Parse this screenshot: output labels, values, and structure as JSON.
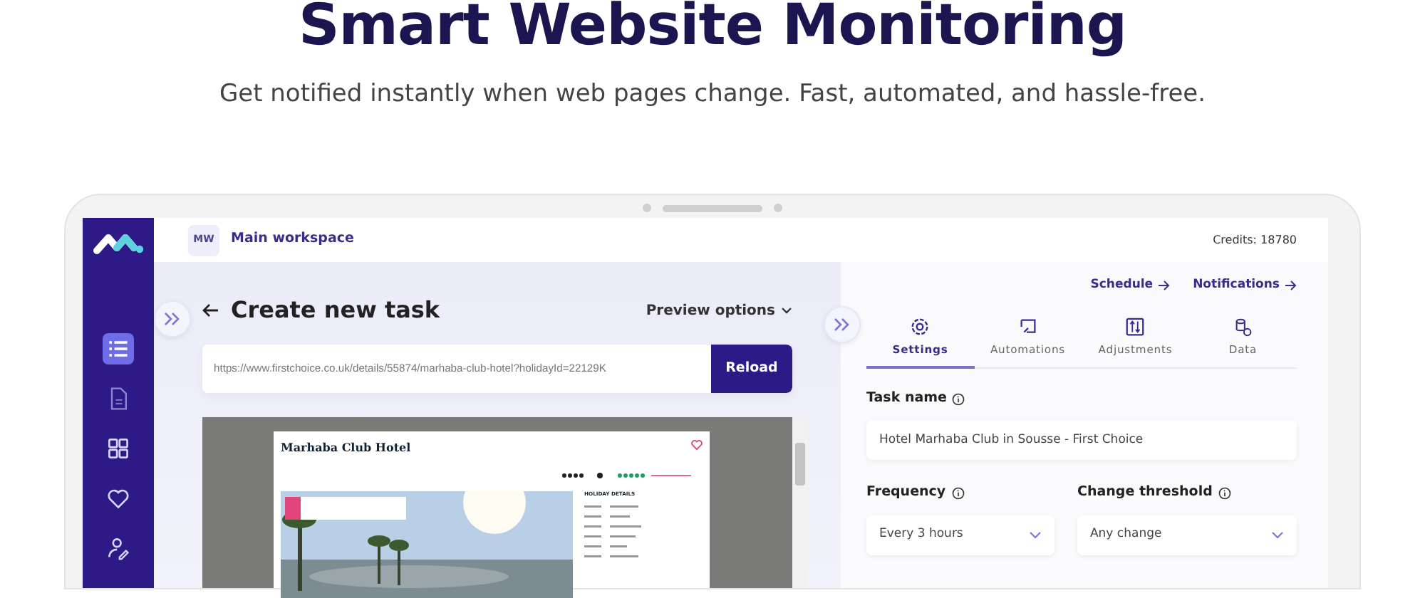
{
  "hero": {
    "title": "Smart Website Monitoring",
    "subtitle": "Get notified instantly when web pages change. Fast, automated, and hassle-free."
  },
  "sidebar": {
    "items": [
      {
        "kind": "list",
        "selected": true
      },
      {
        "kind": "document",
        "selected": false
      },
      {
        "kind": "grid",
        "selected": false
      },
      {
        "kind": "heart",
        "selected": false
      },
      {
        "kind": "user-edit",
        "selected": false
      }
    ]
  },
  "workspace": {
    "badge": "MW",
    "name": "Main workspace"
  },
  "credits": "Credits: 18780",
  "task": {
    "title": "Create new task",
    "preview_options": "Preview options",
    "url": "https://www.firstchoice.co.uk/details/55874/marhaba-club-hotel?holidayId=22129K",
    "reload": "Reload"
  },
  "preview": {
    "site_title": "Marhaba Club Hotel",
    "details_heading": "HOLIDAY DETAILS"
  },
  "links": [
    {
      "label": "Schedule"
    },
    {
      "label": "Notifications"
    }
  ],
  "tabs": [
    {
      "label": "Settings",
      "kind": "gear",
      "selected": true
    },
    {
      "label": "Automations",
      "kind": "automation",
      "selected": false
    },
    {
      "label": "Adjustments",
      "kind": "sliders",
      "selected": false
    },
    {
      "label": "Data",
      "kind": "data",
      "selected": false
    }
  ],
  "form": {
    "task_name": {
      "label": "Task name",
      "value": "Hotel Marhaba Club in Sousse - First Choice"
    },
    "frequency": {
      "label": "Frequency",
      "value": "Every 3 hours"
    },
    "threshold": {
      "label": "Change threshold",
      "value": "Any change"
    }
  }
}
